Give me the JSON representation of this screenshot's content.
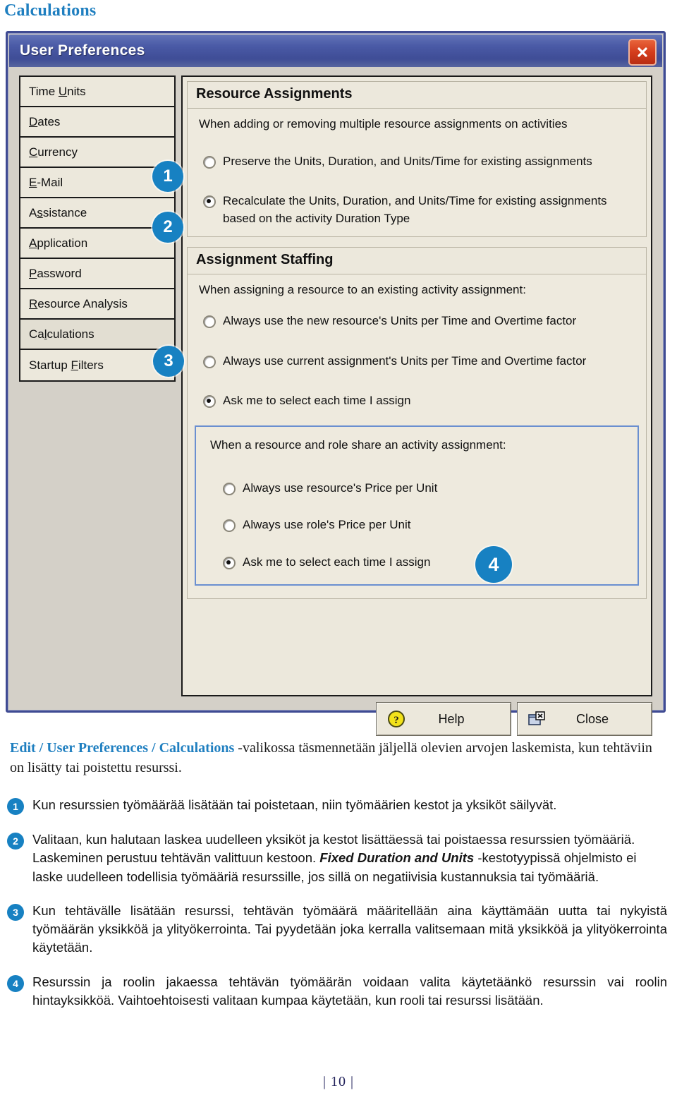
{
  "page": {
    "heading": "Calculations",
    "page_number": "| 10 |",
    "accent_blue": "#1f7fc0",
    "badge_blue": "#1781c2",
    "titlebar_blue": "#4a5aa6",
    "close_button_red": "#d43c1c"
  },
  "dialog": {
    "title": "User Preferences",
    "close_icon": "close-x-icon",
    "sidebar": {
      "items": [
        {
          "label": "Time Units",
          "accel": "U",
          "selected": false
        },
        {
          "label": "Dates",
          "accel": "D",
          "selected": false
        },
        {
          "label": "Currency",
          "accel": "C",
          "selected": false
        },
        {
          "label": "E-Mail",
          "accel": "E",
          "selected": false
        },
        {
          "label": "Assistance",
          "accel": "s",
          "selected": false
        },
        {
          "label": "Application",
          "accel": "A",
          "selected": false
        },
        {
          "label": "Password",
          "accel": "P",
          "selected": false
        },
        {
          "label": "Resource Analysis",
          "accel": "R",
          "selected": false
        },
        {
          "label": "Calculations",
          "accel": "l",
          "selected": true
        },
        {
          "label": "Startup Filters",
          "accel": "F",
          "selected": false
        }
      ]
    },
    "groups": [
      {
        "title": "Resource Assignments",
        "description": "When adding or removing multiple resource assignments on activities",
        "options": [
          {
            "label": "Preserve the Units, Duration, and Units/Time for existing assignments",
            "checked": false
          },
          {
            "label": "Recalculate the Units, Duration, and Units/Time for existing assignments based on the activity Duration Type",
            "checked": true
          }
        ]
      },
      {
        "title": "Assignment Staffing",
        "description": "When assigning a resource to an existing activity assignment:",
        "options": [
          {
            "label": "Always use the new resource's Units per Time and Overtime factor",
            "checked": false
          },
          {
            "label": "Always use current assignment's Units per Time and Overtime factor",
            "checked": false
          },
          {
            "label": "Ask me to select each time I assign",
            "checked": true
          }
        ],
        "subpanel": {
          "description": "When a resource and role share an activity assignment:",
          "options": [
            {
              "label": "Always use resource's Price per Unit",
              "checked": false
            },
            {
              "label": "Always use role's Price per Unit",
              "checked": false
            },
            {
              "label": "Ask me to select each time I assign",
              "checked": true
            }
          ]
        }
      }
    ],
    "buttons": [
      {
        "label": "Help",
        "icon": "help-question-icon"
      },
      {
        "label": "Close",
        "icon": "close-window-icon"
      }
    ]
  },
  "callouts": [
    {
      "number": "1"
    },
    {
      "number": "2"
    },
    {
      "number": "3"
    },
    {
      "number": "4"
    }
  ],
  "caption": {
    "bold_prefix": "Edit / User Preferences / Calculations",
    "rest": " -valikossa täsmennetään jäljellä olevien arvojen laskemista, kun tehtäviin on lisätty tai poistettu resurssi."
  },
  "notes": [
    {
      "number": "1",
      "text": "Kun resurssien työmäärää lisätään tai poistetaan, niin työmäärien kestot ja yksiköt säilyvät.",
      "justify": false
    },
    {
      "number": "2",
      "part1": "Valitaan, kun halutaan laskea uudelleen yksiköt ja kestot lisättäessä tai poistaessa resurssien työmääriä. Laskeminen perustuu tehtävän valittuun kestoon. ",
      "emphasis": "Fixed Duration and Units",
      "part2": " -kestotyypissä ohjelmisto ei laske uudelleen todellisia työmääriä resurssille, jos sillä on negatiivisia kustannuksia tai työmääriä.",
      "justify": false
    },
    {
      "number": "3",
      "text": "Kun tehtävälle lisätään resurssi, tehtävän työmäärä määritellään aina käyttämään uutta tai nykyistä työmäärän yksikköä ja ylityökerrointa. Tai pyydetään joka kerralla valitsemaan mitä yksikköä ja ylityökerrointa käytetään.",
      "justify": true
    },
    {
      "number": "4",
      "text": "Resurssin ja roolin jakaessa tehtävän työmäärän voidaan valita käytetäänkö resurssin vai roolin hintayksikköä. Vaihtoehtoisesti valitaan kumpaa käytetään, kun rooli tai resurssi lisätään.",
      "justify": true
    }
  ]
}
